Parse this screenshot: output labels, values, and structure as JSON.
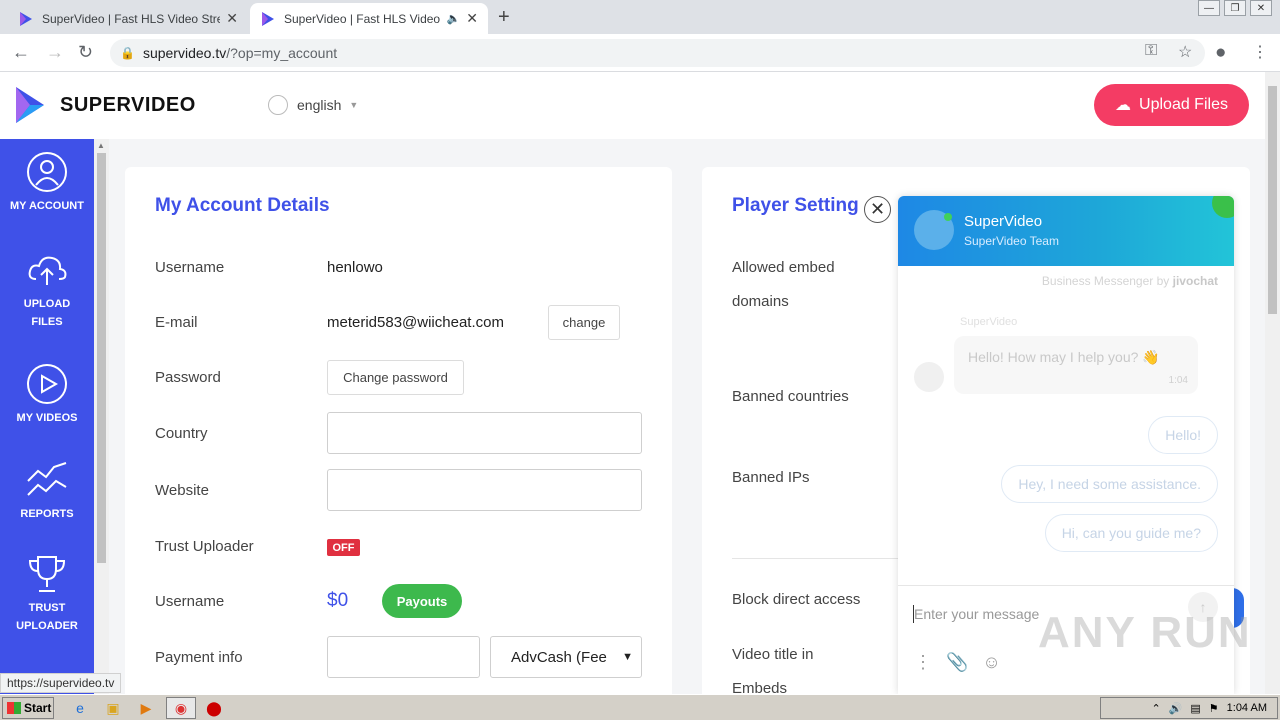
{
  "browser": {
    "tabs": [
      {
        "title": "SuperVideo | Fast HLS Video Streami",
        "active": false
      },
      {
        "title": "SuperVideo | Fast HLS Video Str",
        "active": true
      }
    ],
    "url_host": "supervideo.tv",
    "url_path": "/?op=my_account",
    "status_url": "https://supervideo.tv"
  },
  "header": {
    "brand": "SUPERVIDEO",
    "language": "english",
    "upload_label": "Upload Files",
    "accent_color": "#f43c64"
  },
  "sidebar": {
    "color": "#3f51e8",
    "items": [
      {
        "line1": "MY ACCOUNT",
        "line2": "",
        "icon": "user-icon"
      },
      {
        "line1": "UPLOAD",
        "line2": "FILES",
        "icon": "cloud-upload-icon"
      },
      {
        "line1": "MY VIDEOS",
        "line2": "",
        "icon": "play-icon"
      },
      {
        "line1": "REPORTS",
        "line2": "",
        "icon": "chart-icon"
      },
      {
        "line1": "TRUST",
        "line2": "UPLOADER",
        "icon": "trophy-icon"
      }
    ]
  },
  "account": {
    "title": "My Account Details",
    "username_label": "Username",
    "username_value": "henlowo",
    "email_label": "E-mail",
    "email_value": "meterid583@wiicheat.com",
    "change_label": "change",
    "password_label": "Password",
    "change_password_label": "Change password",
    "country_label": "Country",
    "website_label": "Website",
    "trust_label": "Trust Uploader",
    "trust_value": "OFF",
    "balance_label": "Username",
    "balance_value": "$0",
    "payouts_label": "Payouts",
    "payment_label": "Payment info",
    "payment_method": "AdvCash (Fee"
  },
  "player": {
    "title": "Player Setting",
    "embed_label_1": "Allowed embed",
    "embed_label_2": "domains",
    "banned_countries_label": "Banned countries",
    "banned_ips_label": "Banned IPs",
    "block_direct_label": "Block direct access",
    "video_title_label_1": "Video title in",
    "video_title_label_2": "Embeds"
  },
  "chat": {
    "name": "SuperVideo",
    "team": "SuperVideo Team",
    "powered_prefix": "Business Messenger by",
    "powered_brand": "jivochat",
    "agent_name": "SuperVideo",
    "greeting": "Hello! How may I help you? 👋",
    "greeting_time": "1:04",
    "quick_replies": [
      "Hello!",
      "Hey, I need some assistance.",
      "Hi, can you guide me?"
    ],
    "input_placeholder": "Enter your message"
  },
  "watermark": "ANY RUN",
  "taskbar": {
    "start_label": "Start",
    "clock": "1:04 AM"
  }
}
